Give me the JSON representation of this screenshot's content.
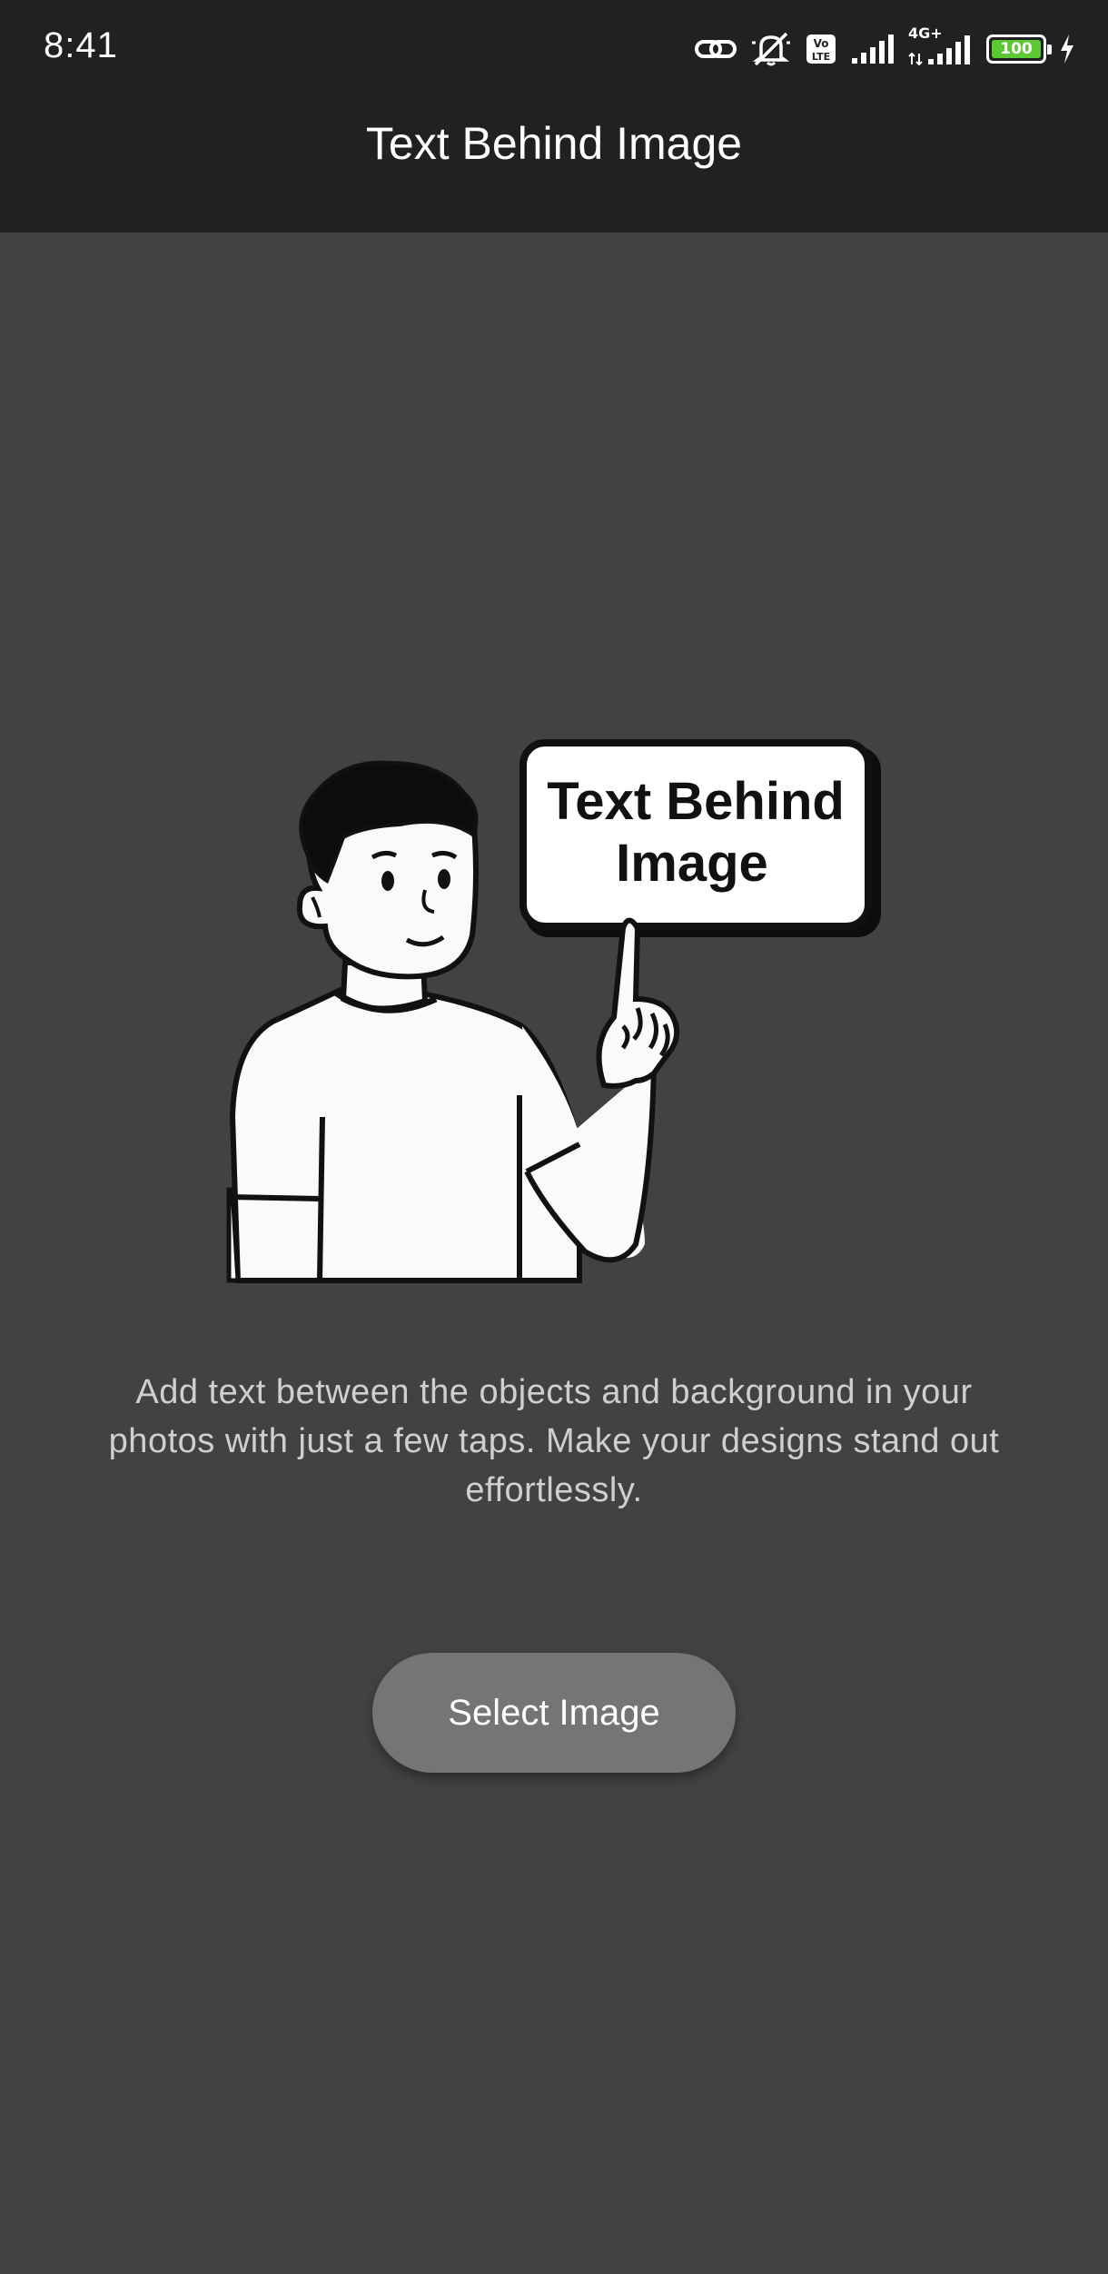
{
  "status_bar": {
    "time": "8:41",
    "network_label": "4G+",
    "volte_label": "Vo LTE",
    "battery_level": "100",
    "icons": [
      "link-icon",
      "silent-mode-icon",
      "volte-icon",
      "signal-icon",
      "signal-4g-icon",
      "battery-icon",
      "charging-icon"
    ]
  },
  "app_bar": {
    "title": "Text Behind Image"
  },
  "illustration": {
    "sign_line_1": "Text Behind",
    "sign_line_2": "Image"
  },
  "main": {
    "description": "Add text between the objects and background in your photos with just a few taps. Make your designs stand out effortlessly.",
    "select_button_label": "Select Image"
  },
  "colors": {
    "background": "#424242",
    "app_bar": "#212121",
    "button": "#757575",
    "battery": "#5cc932"
  }
}
